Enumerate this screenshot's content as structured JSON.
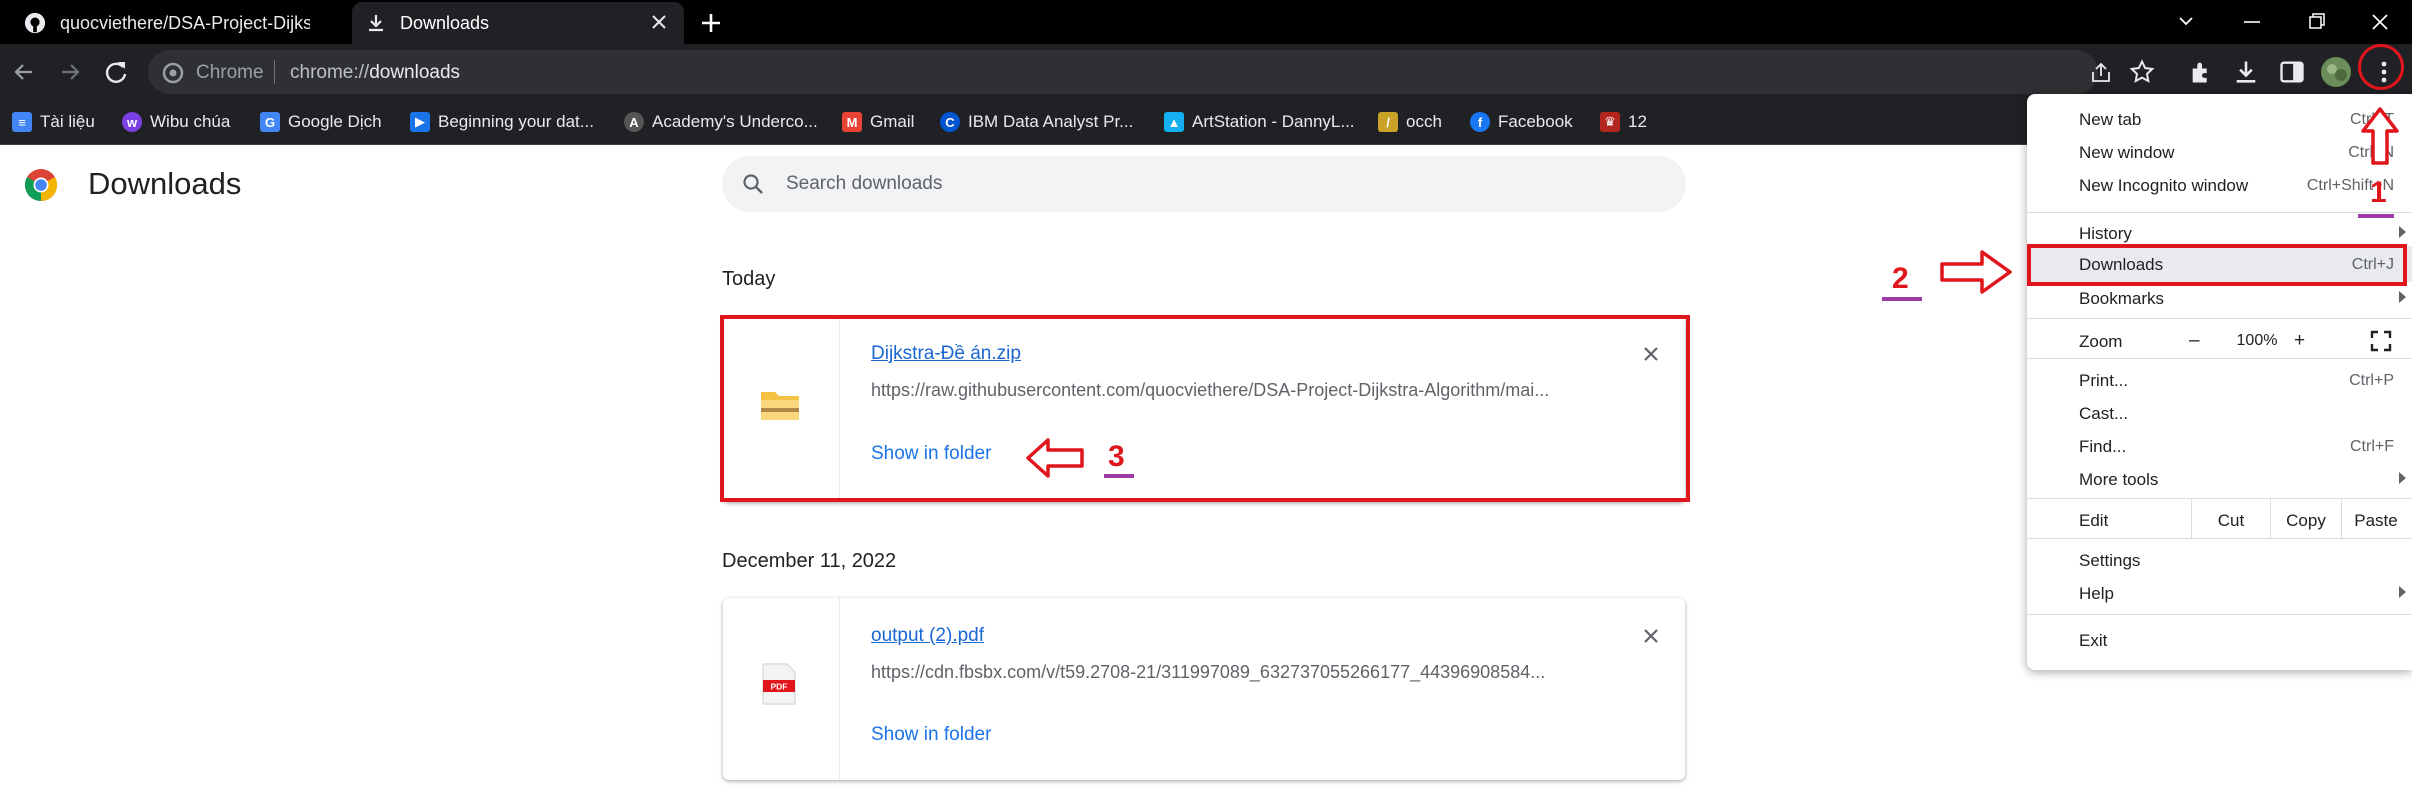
{
  "tabs": [
    {
      "label": "quocviethere/DSA-Project-Dijkstra",
      "icon": "github-icon"
    },
    {
      "label": "Downloads",
      "icon": "download-icon"
    }
  ],
  "omnibox": {
    "origin": "Chrome",
    "url_prefix": "chrome://",
    "url_path": "downloads"
  },
  "bookmarks": [
    {
      "label": "Tài liệu",
      "icon": "docs-icon",
      "color": "#4285f4"
    },
    {
      "label": "Wibu chúa",
      "icon": "wibu-icon",
      "color": "#7b3fe4"
    },
    {
      "label": "Google Dịch",
      "icon": "translate-icon",
      "color": "#4285f4"
    },
    {
      "label": "Beginning your dat...",
      "icon": "page-icon",
      "color": "#1a73e8"
    },
    {
      "label": "Academy's Underco...",
      "icon": "academy-icon",
      "color": "#555555"
    },
    {
      "label": "Gmail",
      "icon": "gmail-icon",
      "color": "#ea4335"
    },
    {
      "label": "IBM Data Analyst Pr...",
      "icon": "coursera-icon",
      "color": "#0056d2"
    },
    {
      "label": "ArtStation - DannyL...",
      "icon": "artstation-icon",
      "color": "#13aff0"
    },
    {
      "label": "occh",
      "icon": "occh-icon",
      "color": "#c9a227"
    },
    {
      "label": "Facebook",
      "icon": "facebook-icon",
      "color": "#1877f2"
    },
    {
      "label": "12",
      "icon": "game-icon",
      "color": "#b3261e"
    }
  ],
  "page": {
    "title": "Downloads",
    "search_placeholder": "Search downloads"
  },
  "groups": [
    {
      "date": "Today",
      "items": [
        {
          "name": "Dijkstra-Đề án.zip",
          "url": "https://raw.githubusercontent.com/quocviethere/DSA-Project-Dijkstra-Algorithm/mai...",
          "action": "Show in folder",
          "icon": "zip-folder-icon"
        }
      ]
    },
    {
      "date": "December 11, 2022",
      "items": [
        {
          "name": "output (2).pdf",
          "url": "https://cdn.fbsbx.com/v/t59.2708-21/311997089_632737055266177_44396908584...",
          "action": "Show in folder",
          "icon": "pdf-icon"
        }
      ]
    }
  ],
  "menu": {
    "items": [
      {
        "label": "New tab",
        "shortcut": "Ctrl+T"
      },
      {
        "label": "New window",
        "shortcut": "Ctrl+N"
      },
      {
        "label": "New Incognito window",
        "shortcut": "Ctrl+Shift+N"
      },
      {
        "label": "History"
      },
      {
        "label": "Downloads",
        "shortcut": "Ctrl+J"
      },
      {
        "label": "Bookmarks"
      },
      {
        "label": "Zoom",
        "minus": "–",
        "value": "100%",
        "plus": "+"
      },
      {
        "label": "Print...",
        "shortcut": "Ctrl+P"
      },
      {
        "label": "Cast..."
      },
      {
        "label": "Find...",
        "shortcut": "Ctrl+F"
      },
      {
        "label": "More tools"
      },
      {
        "label": "Edit",
        "cut": "Cut",
        "copy": "Copy",
        "paste": "Paste"
      },
      {
        "label": "Settings"
      },
      {
        "label": "Help"
      },
      {
        "label": "Exit"
      }
    ]
  },
  "annotations": {
    "step1": "1",
    "step2": "2",
    "step3": "3",
    "color": "#e1151c",
    "underline_color": "#9c3ba6"
  },
  "colors": {
    "link": "#1967d2",
    "tab_active_bg": "#202124",
    "titlebar_bg": "#000000"
  }
}
